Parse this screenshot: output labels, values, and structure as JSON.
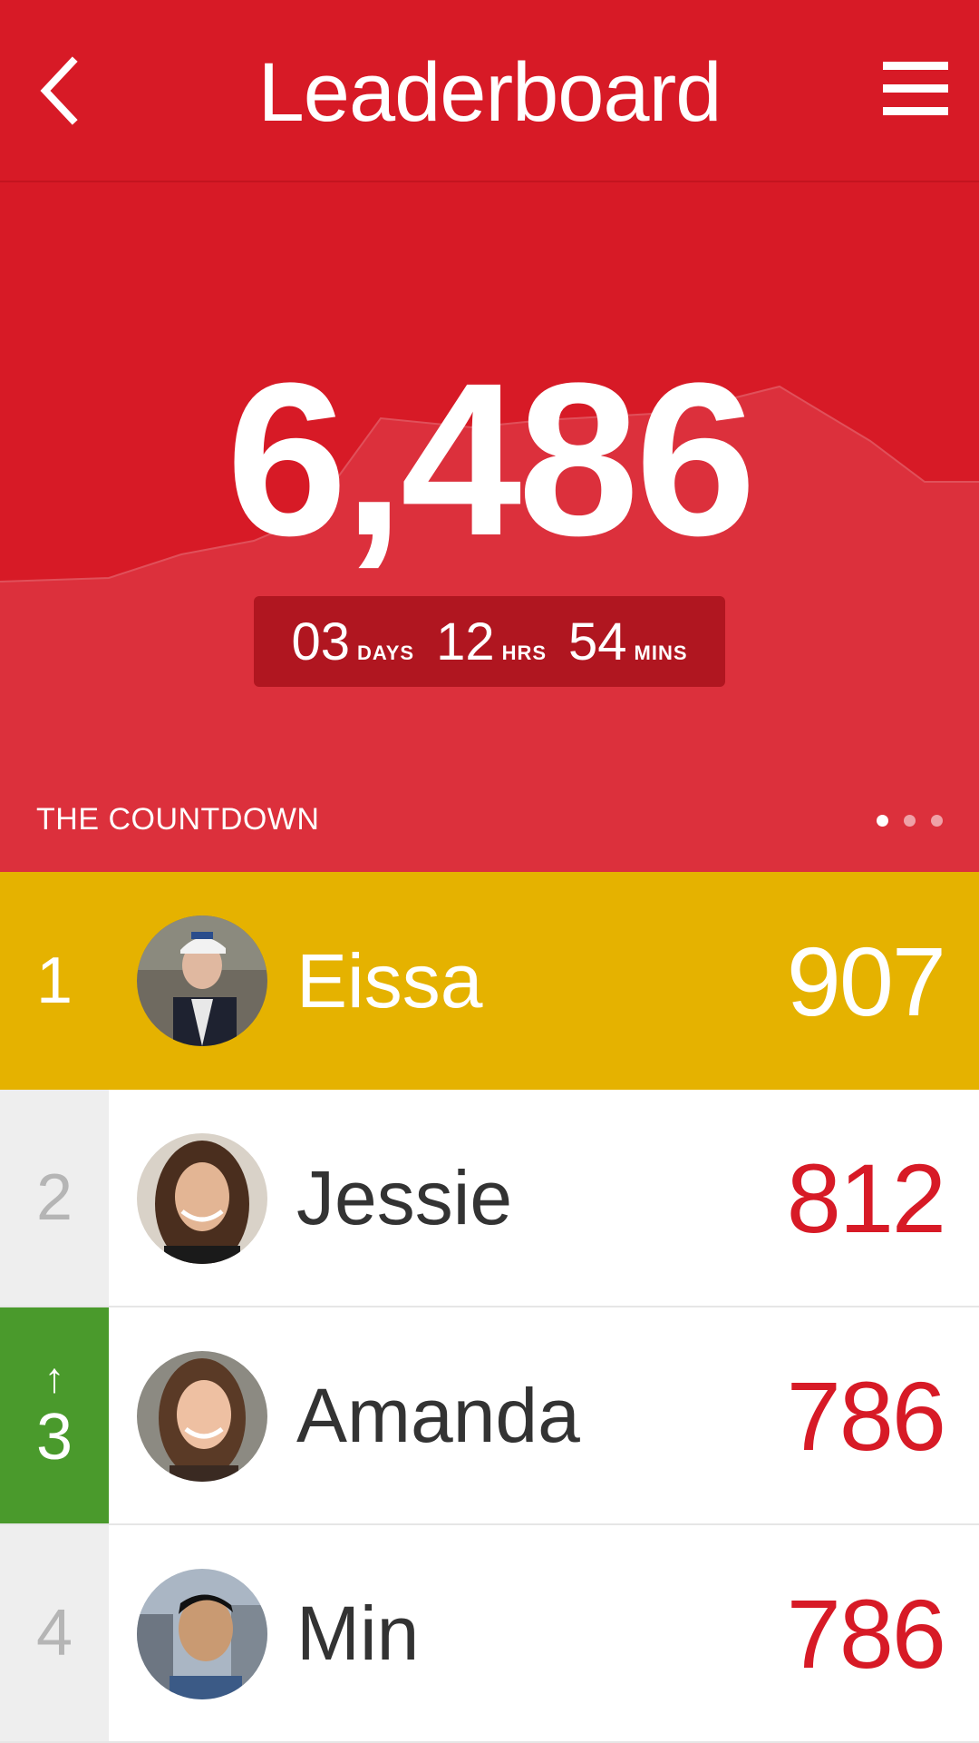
{
  "header": {
    "title": "Leaderboard",
    "back_icon": "chevron-left-icon",
    "menu_icon": "hamburger-menu-icon",
    "color": "#d71a26"
  },
  "countdown": {
    "total": "6,486",
    "days": "03",
    "days_label": "DAYS",
    "hours": "12",
    "hours_label": "HRS",
    "minutes": "54",
    "minutes_label": "MINS",
    "section_label": "THE COUNTDOWN",
    "page_count": 3,
    "active_page": 1
  },
  "leaderboard": [
    {
      "rank": "1",
      "name": "Eissa",
      "score": "907",
      "highlight": "#e5b200"
    },
    {
      "rank": "2",
      "name": "Jessie",
      "score": "812"
    },
    {
      "rank": "3",
      "name": "Amanda",
      "score": "786",
      "movement": "up",
      "movement_icon": "arrow-up-icon",
      "highlight": "#4a9a2c"
    },
    {
      "rank": "4",
      "name": "Min",
      "score": "786"
    }
  ]
}
